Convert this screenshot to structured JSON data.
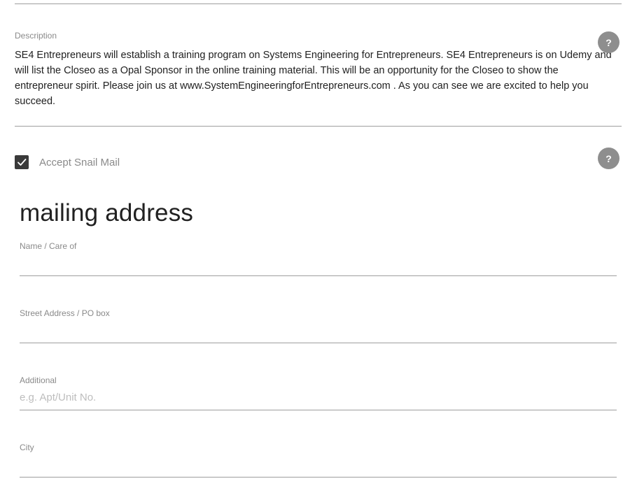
{
  "description": {
    "label": "Description",
    "text": "SE4 Entrepreneurs will establish a training program on Systems Engineering for Entrepreneurs.  SE4 Entrepreneurs is on Udemy and will list the Closeo as a Opal Sponsor in the online training material.  This will be an opportunity for the Closeo to show the entrepreneur spirit.  Please join us at www.SystemEngineeringforEntrepreneurs.com . As you can see we are excited to help you succeed."
  },
  "help_label": "?",
  "snail_mail": {
    "label": "Accept Snail Mail",
    "checked": true
  },
  "mailing_address": {
    "title": "mailing address",
    "fields": [
      {
        "label": "Name / Care of",
        "value": "",
        "placeholder": ""
      },
      {
        "label": "Street Address / PO box",
        "value": "",
        "placeholder": ""
      },
      {
        "label": "Additional",
        "value": "",
        "placeholder": "e.g. Apt/Unit No."
      },
      {
        "label": "City",
        "value": "",
        "placeholder": ""
      }
    ]
  },
  "colors": {
    "checkbox": "#3a3a3a",
    "help_badge": "#8e8e8e",
    "divider": "#9e9e9e",
    "label_grey": "#8a8a8a"
  },
  "icons": {
    "help": "question-mark-circle-icon",
    "check": "checkmark-icon"
  }
}
